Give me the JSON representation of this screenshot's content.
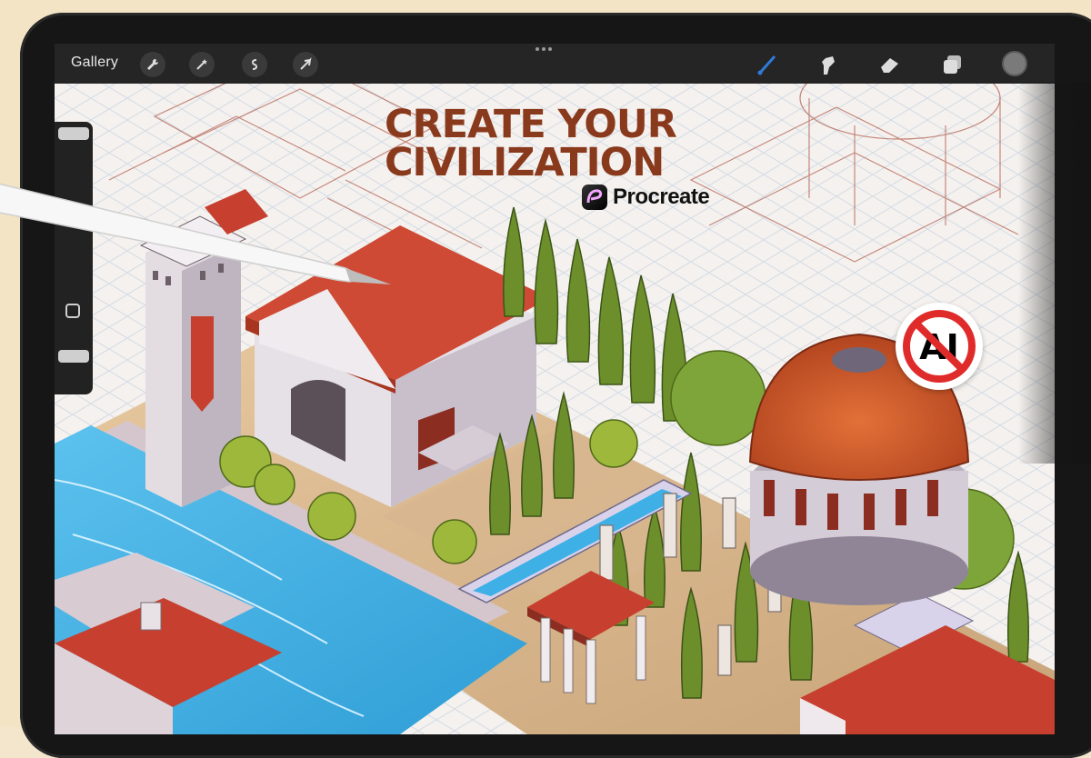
{
  "app": {
    "toolbar": {
      "gallery_label": "Gallery",
      "left_tools": [
        "wrench-icon",
        "magic-wand-icon",
        "selection-icon",
        "transform-arrow-icon"
      ],
      "right_tools": [
        "brush-icon",
        "smudge-icon",
        "eraser-icon",
        "layers-icon",
        "color-swatch"
      ]
    }
  },
  "artwork": {
    "headline_line1": "CREATE YOUR",
    "headline_line2": "CIVILIZATION",
    "brand": "Procreate",
    "badge": "AI"
  },
  "colors": {
    "headline": "#8a3a1c",
    "toolbar_bg": "#252525",
    "active_brush": "#2f7bd8",
    "roof_red": "#c7402f",
    "water_blue": "#3fb0e6",
    "tree_green": "#6d8f2b"
  }
}
